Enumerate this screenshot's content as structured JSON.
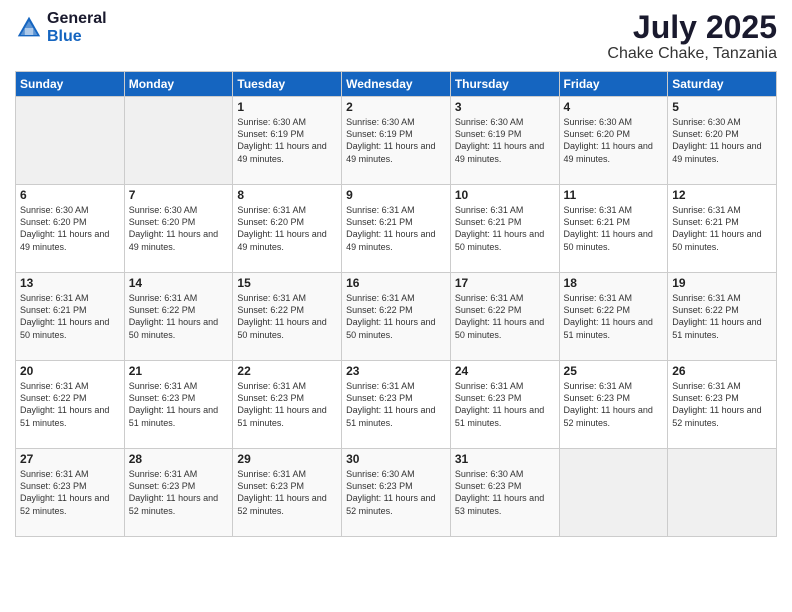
{
  "logo": {
    "general": "General",
    "blue": "Blue"
  },
  "title": {
    "month": "July 2025",
    "location": "Chake Chake, Tanzania"
  },
  "weekdays": [
    "Sunday",
    "Monday",
    "Tuesday",
    "Wednesday",
    "Thursday",
    "Friday",
    "Saturday"
  ],
  "weeks": [
    [
      {
        "day": "",
        "info": ""
      },
      {
        "day": "",
        "info": ""
      },
      {
        "day": "1",
        "info": "Sunrise: 6:30 AM\nSunset: 6:19 PM\nDaylight: 11 hours and 49 minutes."
      },
      {
        "day": "2",
        "info": "Sunrise: 6:30 AM\nSunset: 6:19 PM\nDaylight: 11 hours and 49 minutes."
      },
      {
        "day": "3",
        "info": "Sunrise: 6:30 AM\nSunset: 6:19 PM\nDaylight: 11 hours and 49 minutes."
      },
      {
        "day": "4",
        "info": "Sunrise: 6:30 AM\nSunset: 6:20 PM\nDaylight: 11 hours and 49 minutes."
      },
      {
        "day": "5",
        "info": "Sunrise: 6:30 AM\nSunset: 6:20 PM\nDaylight: 11 hours and 49 minutes."
      }
    ],
    [
      {
        "day": "6",
        "info": "Sunrise: 6:30 AM\nSunset: 6:20 PM\nDaylight: 11 hours and 49 minutes."
      },
      {
        "day": "7",
        "info": "Sunrise: 6:30 AM\nSunset: 6:20 PM\nDaylight: 11 hours and 49 minutes."
      },
      {
        "day": "8",
        "info": "Sunrise: 6:31 AM\nSunset: 6:20 PM\nDaylight: 11 hours and 49 minutes."
      },
      {
        "day": "9",
        "info": "Sunrise: 6:31 AM\nSunset: 6:21 PM\nDaylight: 11 hours and 49 minutes."
      },
      {
        "day": "10",
        "info": "Sunrise: 6:31 AM\nSunset: 6:21 PM\nDaylight: 11 hours and 50 minutes."
      },
      {
        "day": "11",
        "info": "Sunrise: 6:31 AM\nSunset: 6:21 PM\nDaylight: 11 hours and 50 minutes."
      },
      {
        "day": "12",
        "info": "Sunrise: 6:31 AM\nSunset: 6:21 PM\nDaylight: 11 hours and 50 minutes."
      }
    ],
    [
      {
        "day": "13",
        "info": "Sunrise: 6:31 AM\nSunset: 6:21 PM\nDaylight: 11 hours and 50 minutes."
      },
      {
        "day": "14",
        "info": "Sunrise: 6:31 AM\nSunset: 6:22 PM\nDaylight: 11 hours and 50 minutes."
      },
      {
        "day": "15",
        "info": "Sunrise: 6:31 AM\nSunset: 6:22 PM\nDaylight: 11 hours and 50 minutes."
      },
      {
        "day": "16",
        "info": "Sunrise: 6:31 AM\nSunset: 6:22 PM\nDaylight: 11 hours and 50 minutes."
      },
      {
        "day": "17",
        "info": "Sunrise: 6:31 AM\nSunset: 6:22 PM\nDaylight: 11 hours and 50 minutes."
      },
      {
        "day": "18",
        "info": "Sunrise: 6:31 AM\nSunset: 6:22 PM\nDaylight: 11 hours and 51 minutes."
      },
      {
        "day": "19",
        "info": "Sunrise: 6:31 AM\nSunset: 6:22 PM\nDaylight: 11 hours and 51 minutes."
      }
    ],
    [
      {
        "day": "20",
        "info": "Sunrise: 6:31 AM\nSunset: 6:22 PM\nDaylight: 11 hours and 51 minutes."
      },
      {
        "day": "21",
        "info": "Sunrise: 6:31 AM\nSunset: 6:23 PM\nDaylight: 11 hours and 51 minutes."
      },
      {
        "day": "22",
        "info": "Sunrise: 6:31 AM\nSunset: 6:23 PM\nDaylight: 11 hours and 51 minutes."
      },
      {
        "day": "23",
        "info": "Sunrise: 6:31 AM\nSunset: 6:23 PM\nDaylight: 11 hours and 51 minutes."
      },
      {
        "day": "24",
        "info": "Sunrise: 6:31 AM\nSunset: 6:23 PM\nDaylight: 11 hours and 51 minutes."
      },
      {
        "day": "25",
        "info": "Sunrise: 6:31 AM\nSunset: 6:23 PM\nDaylight: 11 hours and 52 minutes."
      },
      {
        "day": "26",
        "info": "Sunrise: 6:31 AM\nSunset: 6:23 PM\nDaylight: 11 hours and 52 minutes."
      }
    ],
    [
      {
        "day": "27",
        "info": "Sunrise: 6:31 AM\nSunset: 6:23 PM\nDaylight: 11 hours and 52 minutes."
      },
      {
        "day": "28",
        "info": "Sunrise: 6:31 AM\nSunset: 6:23 PM\nDaylight: 11 hours and 52 minutes."
      },
      {
        "day": "29",
        "info": "Sunrise: 6:31 AM\nSunset: 6:23 PM\nDaylight: 11 hours and 52 minutes."
      },
      {
        "day": "30",
        "info": "Sunrise: 6:30 AM\nSunset: 6:23 PM\nDaylight: 11 hours and 52 minutes."
      },
      {
        "day": "31",
        "info": "Sunrise: 6:30 AM\nSunset: 6:23 PM\nDaylight: 11 hours and 53 minutes."
      },
      {
        "day": "",
        "info": ""
      },
      {
        "day": "",
        "info": ""
      }
    ]
  ]
}
